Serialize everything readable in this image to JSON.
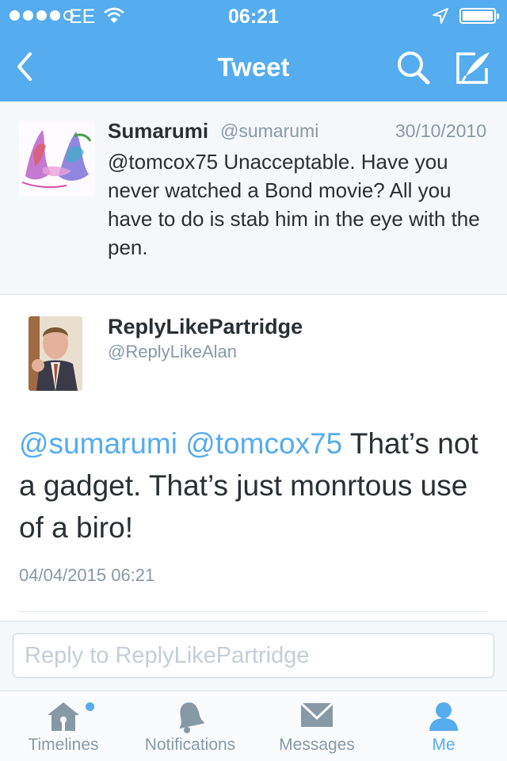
{
  "status_bar": {
    "carrier": "EE",
    "time": "06:21",
    "signal_bars_filled": 4,
    "signal_bars_total": 5,
    "battery_level": 1.0
  },
  "nav": {
    "title": "Tweet",
    "back_icon": "chevron-left-icon",
    "search_icon": "search-icon",
    "compose_icon": "compose-icon"
  },
  "parent_tweet": {
    "name": "Sumarumi",
    "handle": "@sumarumi",
    "date": "30/10/2010",
    "text": "@tomcox75 Unacceptable. Have you never watched a Bond movie? All you have to do is stab him in the eye with the pen."
  },
  "main_tweet": {
    "name": "ReplyLikePartridge",
    "handle": "@ReplyLikeAlan",
    "mention_1": "@sumarumi",
    "mention_2": "@tomcox75",
    "text": "That’s not a gadget. That’s just monrtous use of a biro!",
    "timestamp": "04/04/2015 06:21"
  },
  "reply": {
    "placeholder": "Reply to ReplyLikePartridge",
    "value": ""
  },
  "tabs": [
    {
      "label": "Timelines",
      "icon": "home-icon",
      "active": false,
      "has_badge": true
    },
    {
      "label": "Notifications",
      "icon": "bell-icon",
      "active": false
    },
    {
      "label": "Messages",
      "icon": "envelope-icon",
      "active": false
    },
    {
      "label": "Me",
      "icon": "person-icon",
      "active": true
    }
  ],
  "colors": {
    "accent": "#55acee",
    "text": "#292f33",
    "muted": "#8899a6",
    "parent_bg": "#f5f8fa"
  }
}
